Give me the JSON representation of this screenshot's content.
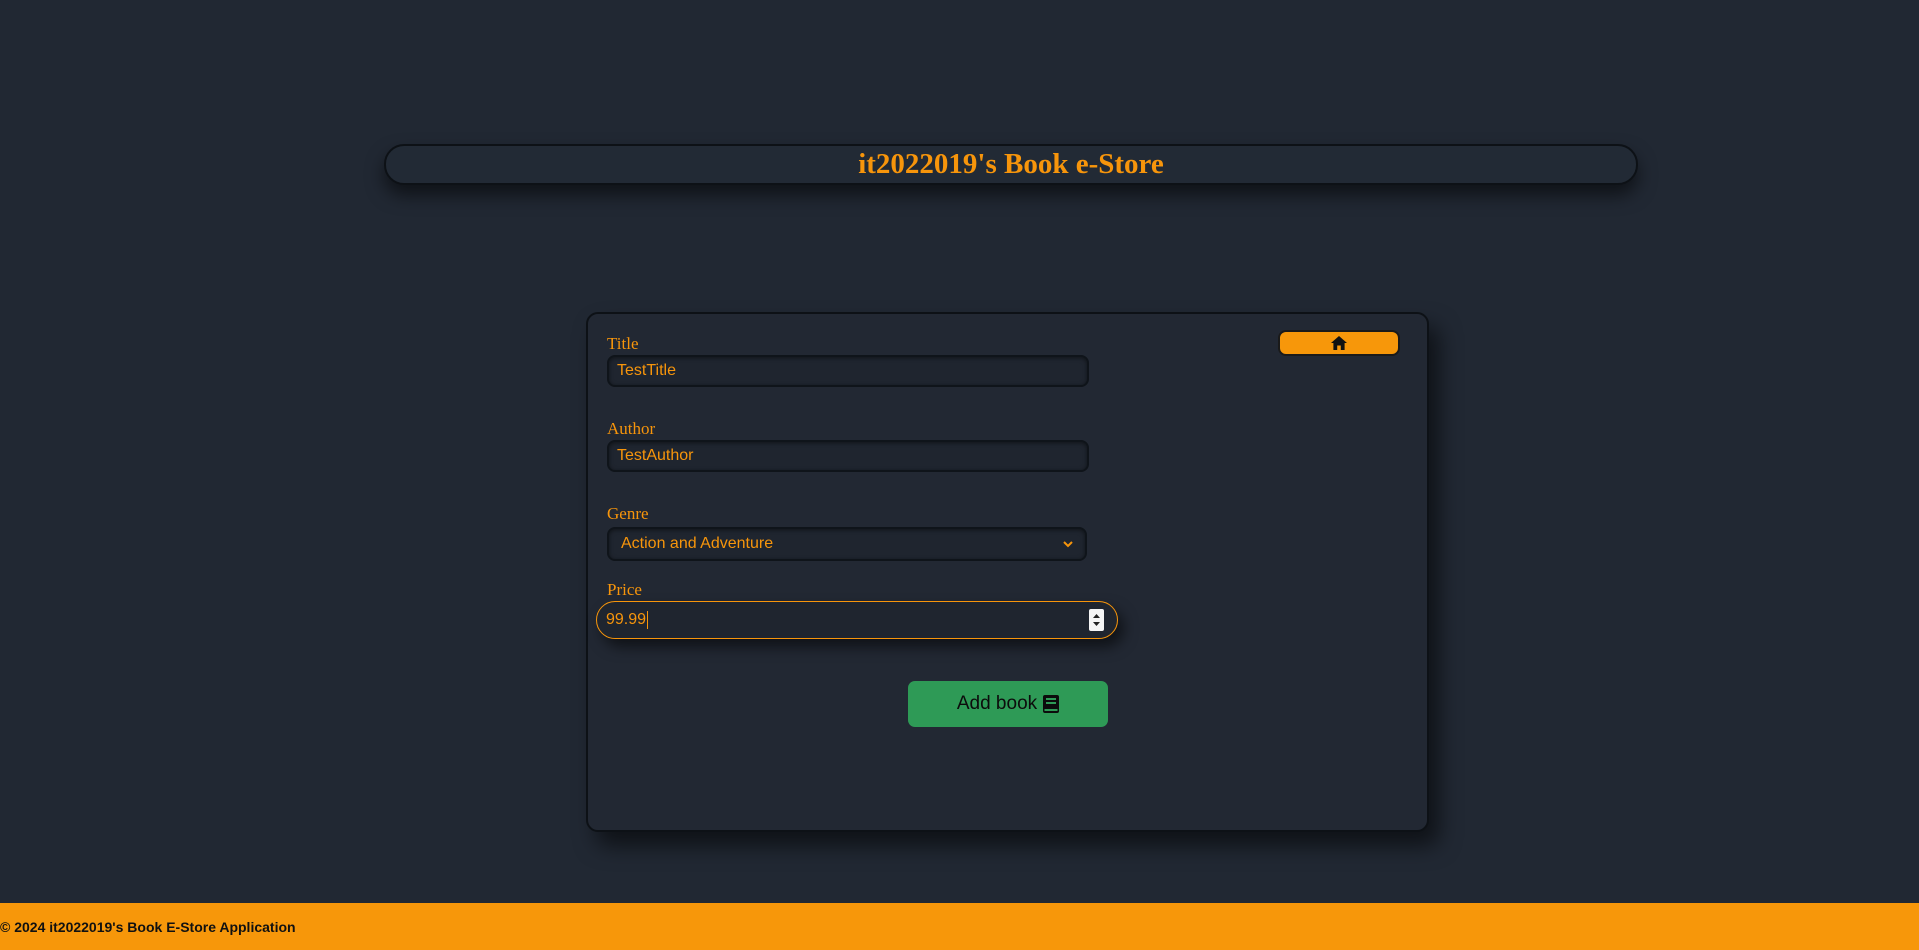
{
  "header": {
    "title": "it2022019's Book e-Store"
  },
  "form": {
    "home_icon": "home-icon",
    "title_label": "Title",
    "title_value": "TestTitle",
    "author_label": "Author",
    "author_value": "TestAuthor",
    "genre_label": "Genre",
    "genre_value": "Action and Adventure",
    "price_label": "Price",
    "price_value": "99.99",
    "submit_label": "Add book",
    "submit_icon": "book-icon"
  },
  "footer": {
    "text": "© 2024 it2022019's Book E-Store Application"
  },
  "colors": {
    "background": "#212833",
    "accent": "#f7950b",
    "submit": "#2e9a56"
  }
}
